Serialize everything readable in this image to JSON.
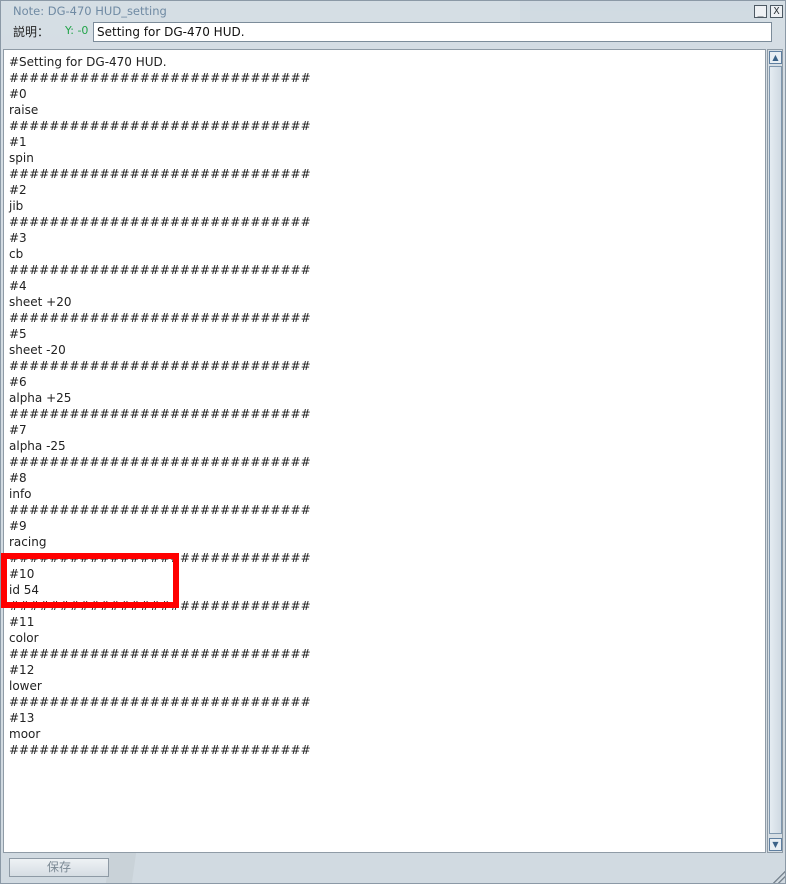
{
  "window": {
    "title": "Note: DG-470 HUD_setting",
    "minimize_label": "_",
    "close_label": "X"
  },
  "description": {
    "label": "説明：",
    "coord_text": "Y: -0",
    "value": "Setting for DG-470 HUD."
  },
  "notecard": {
    "lines": [
      "#Setting for DG-470 HUD.",
      "##############################",
      "#0",
      "raise",
      "##############################",
      "#1",
      "spin",
      "##############################",
      "#2",
      "jib",
      "##############################",
      "#3",
      "cb",
      "##############################",
      "#4",
      "sheet +20",
      "##############################",
      "#5",
      "sheet -20",
      "##############################",
      "#6",
      "alpha +25",
      "##############################",
      "#7",
      "alpha -25",
      "##############################",
      "#8",
      "info",
      "##############################",
      "#9",
      "racing",
      "##############################",
      "#10",
      "id 54",
      "##############################",
      "#11",
      "color",
      "##############################",
      "#12",
      "lower",
      "##############################",
      "#13",
      "moor",
      "##############################"
    ]
  },
  "footer": {
    "save_label": "保存"
  },
  "highlight": {
    "color": "#ff0000",
    "target_lines": [
      "#10",
      "id 54"
    ]
  },
  "icons": {
    "scroll_up": "chevron-up-icon",
    "scroll_down": "chevron-down-icon",
    "resize": "resize-grip-icon"
  }
}
